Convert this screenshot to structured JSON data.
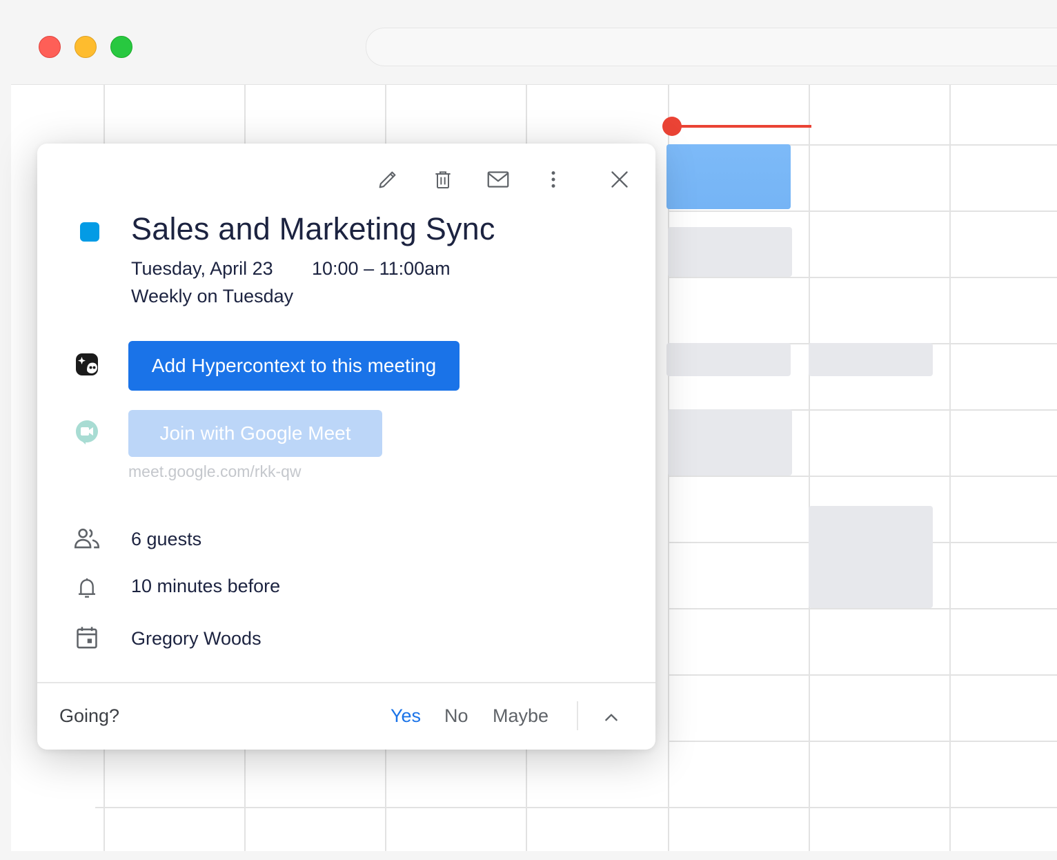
{
  "event": {
    "title": "Sales and Marketing Sync",
    "date": "Tuesday, April 23",
    "time": "10:00 – 11:00am",
    "recurrence": "Weekly on Tuesday",
    "color": "#039be5"
  },
  "actions": {
    "hypercontext_button": "Add Hypercontext to this meeting",
    "meet_button": "Join with Google Meet",
    "meet_link": "meet.google.com/rkk-qw"
  },
  "details": {
    "guests": "6 guests",
    "reminder": "10 minutes before",
    "organizer": "Gregory Woods"
  },
  "rsvp": {
    "prompt": "Going?",
    "yes": "Yes",
    "no": "No",
    "maybe": "Maybe",
    "selected": "yes"
  },
  "toolbar_icons": [
    "edit-icon",
    "delete-icon",
    "email-icon",
    "more-vert-icon",
    "close-icon"
  ],
  "colors": {
    "primary": "#1a73e8",
    "now_indicator": "#ea4335",
    "event_block": "#7dbaf8"
  }
}
